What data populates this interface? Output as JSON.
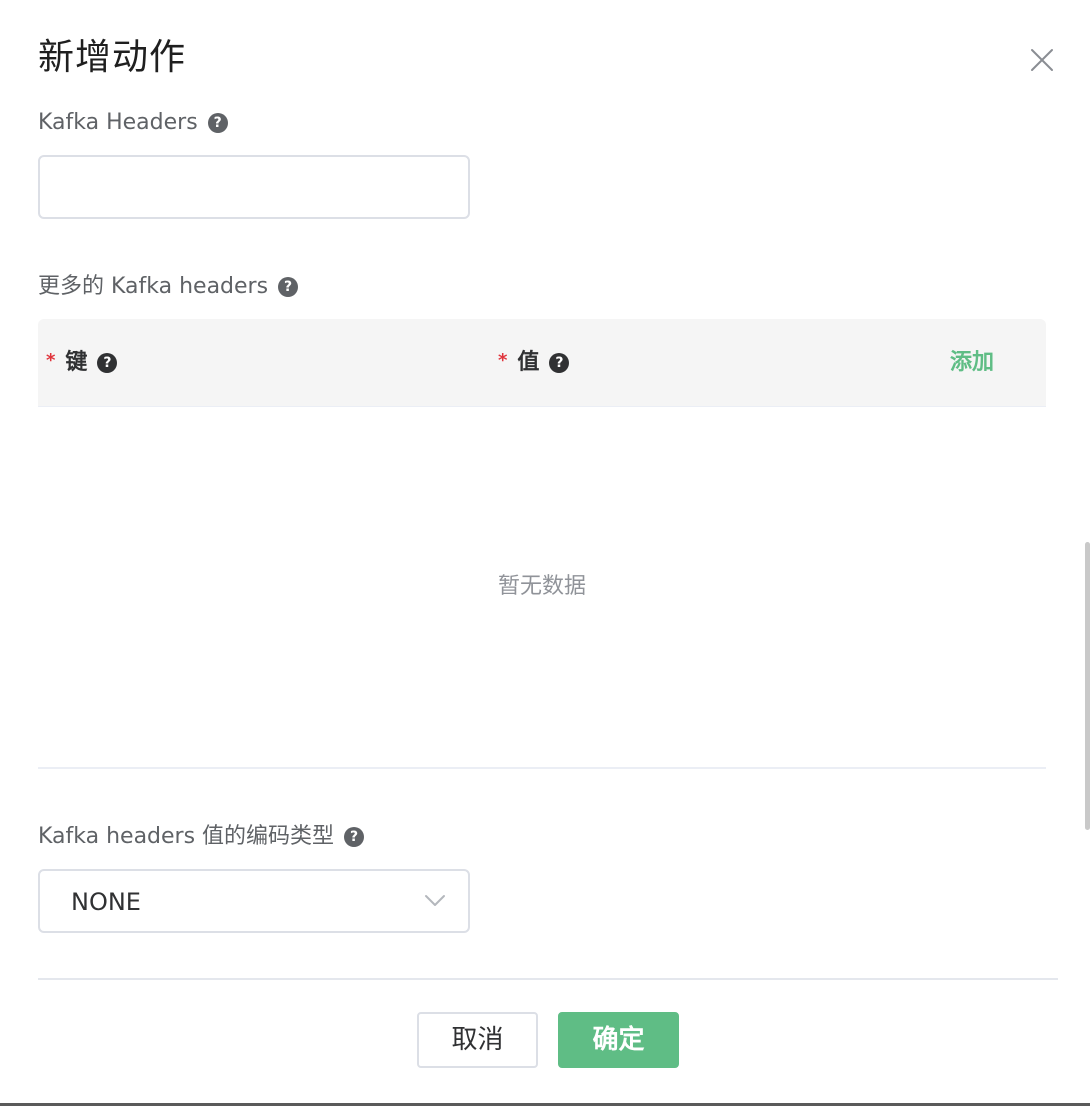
{
  "dialog": {
    "title": "新增动作",
    "close_icon": "close-icon"
  },
  "fields": {
    "kafka_headers": {
      "label": "Kafka Headers",
      "help": "?",
      "value": "",
      "placeholder": ""
    },
    "more_headers": {
      "label": "更多的 Kafka headers",
      "help": "?",
      "table": {
        "columns": [
          {
            "label": "键",
            "required_mark": "*",
            "help": "?"
          },
          {
            "label": "值",
            "required_mark": "*",
            "help": "?"
          }
        ],
        "add_label": "添加",
        "empty_text": "暂无数据",
        "rows": []
      }
    },
    "encoding": {
      "label": "Kafka headers 值的编码类型",
      "help": "?",
      "value": "NONE",
      "arrow_icon": "chevron-down-icon"
    }
  },
  "footer": {
    "cancel_label": "取消",
    "confirm_label": "确定"
  },
  "colors": {
    "accent": "#5fbd85",
    "required": "#e0343c",
    "border": "#dcdfe6",
    "header_bg": "#f5f5f5"
  }
}
